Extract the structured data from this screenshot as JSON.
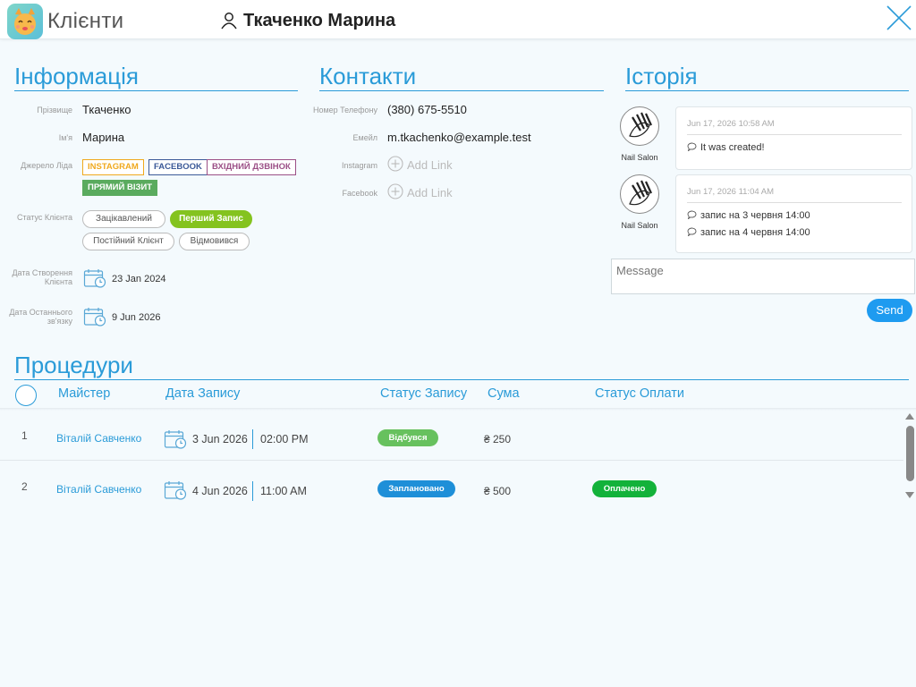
{
  "header": {
    "app_title": "Клієнти",
    "client_name": "Ткаченко Марина"
  },
  "info": {
    "title": "Інформація",
    "surname_label": "Прізвище",
    "surname": "Ткаченко",
    "name_label": "Ім'я",
    "name": "Марина",
    "source_label": "Джерело Ліда",
    "sources": [
      {
        "label": "INSTAGRAM",
        "color": "#f0a91e"
      },
      {
        "label": "FACEBOOK",
        "color": "#3b5998"
      },
      {
        "label": "ВХІДНИЙ ДЗВІНОК",
        "color": "#9b4f86"
      },
      {
        "label": "ПРЯМИЙ ВІЗИТ",
        "color": "#5aab5e"
      }
    ],
    "status_label": "Статус Клієнта",
    "statuses": [
      {
        "label": "Зацікавлений",
        "active": false
      },
      {
        "label": "Перший Запис",
        "active": true
      },
      {
        "label": "Постійний Клієнт",
        "active": false
      },
      {
        "label": "Відмовився",
        "active": false
      }
    ],
    "created_label_1": "Дата Створення",
    "created_label_2": "Клієнта",
    "created_date": "23 Jan 2024",
    "last_contact_label_1": "Дата Останнього",
    "last_contact_label_2": "зв'язку",
    "last_contact_date": "9 Jun 2026"
  },
  "contacts": {
    "title": "Контакти",
    "phone_label": "Номер Телефону",
    "phone": "(380) 675-5510",
    "email_label": "Емейл",
    "email": "m.tkachenko@example.test",
    "instagram_label": "Instagram",
    "facebook_label": "Facebook",
    "add_link": "Add Link"
  },
  "history": {
    "title": "Історія",
    "entries": [
      {
        "author": "Nail Salon",
        "date": "Jun 17, 2026 10:58 AM",
        "messages": [
          "It was created!"
        ]
      },
      {
        "author": "Nail Salon",
        "date": "Jun 17, 2026 11:04 AM",
        "messages": [
          "запис на 3 червня 14:00",
          "запис на 4 червня 14:00"
        ]
      }
    ],
    "message_placeholder": "Message",
    "send_label": "Send"
  },
  "procedures": {
    "title": "Процедури",
    "columns": {
      "master": "Майстер",
      "date": "Дата Запису",
      "status": "Статус Запису",
      "sum": "Сума",
      "payment": "Статус Оплати"
    },
    "rows": [
      {
        "num": "1",
        "master": "Віталій Савченко",
        "date": "3 Jun 2026",
        "time": "02:00 PM",
        "status": "Відбувся",
        "status_color": "#67c15e",
        "sum": "₴ 250",
        "payment": "",
        "payment_color": ""
      },
      {
        "num": "2",
        "master": "Віталій Савченко",
        "date": "4 Jun 2026",
        "time": "11:00 AM",
        "status": "Заплановано",
        "status_color": "#1e8fd8",
        "sum": "₴ 500",
        "payment": "Оплачено",
        "payment_color": "#13b23a"
      }
    ]
  },
  "colors": {
    "accent": "#2a9bd8",
    "active_status": "#84c31f",
    "send_button": "#1e9bf0"
  }
}
